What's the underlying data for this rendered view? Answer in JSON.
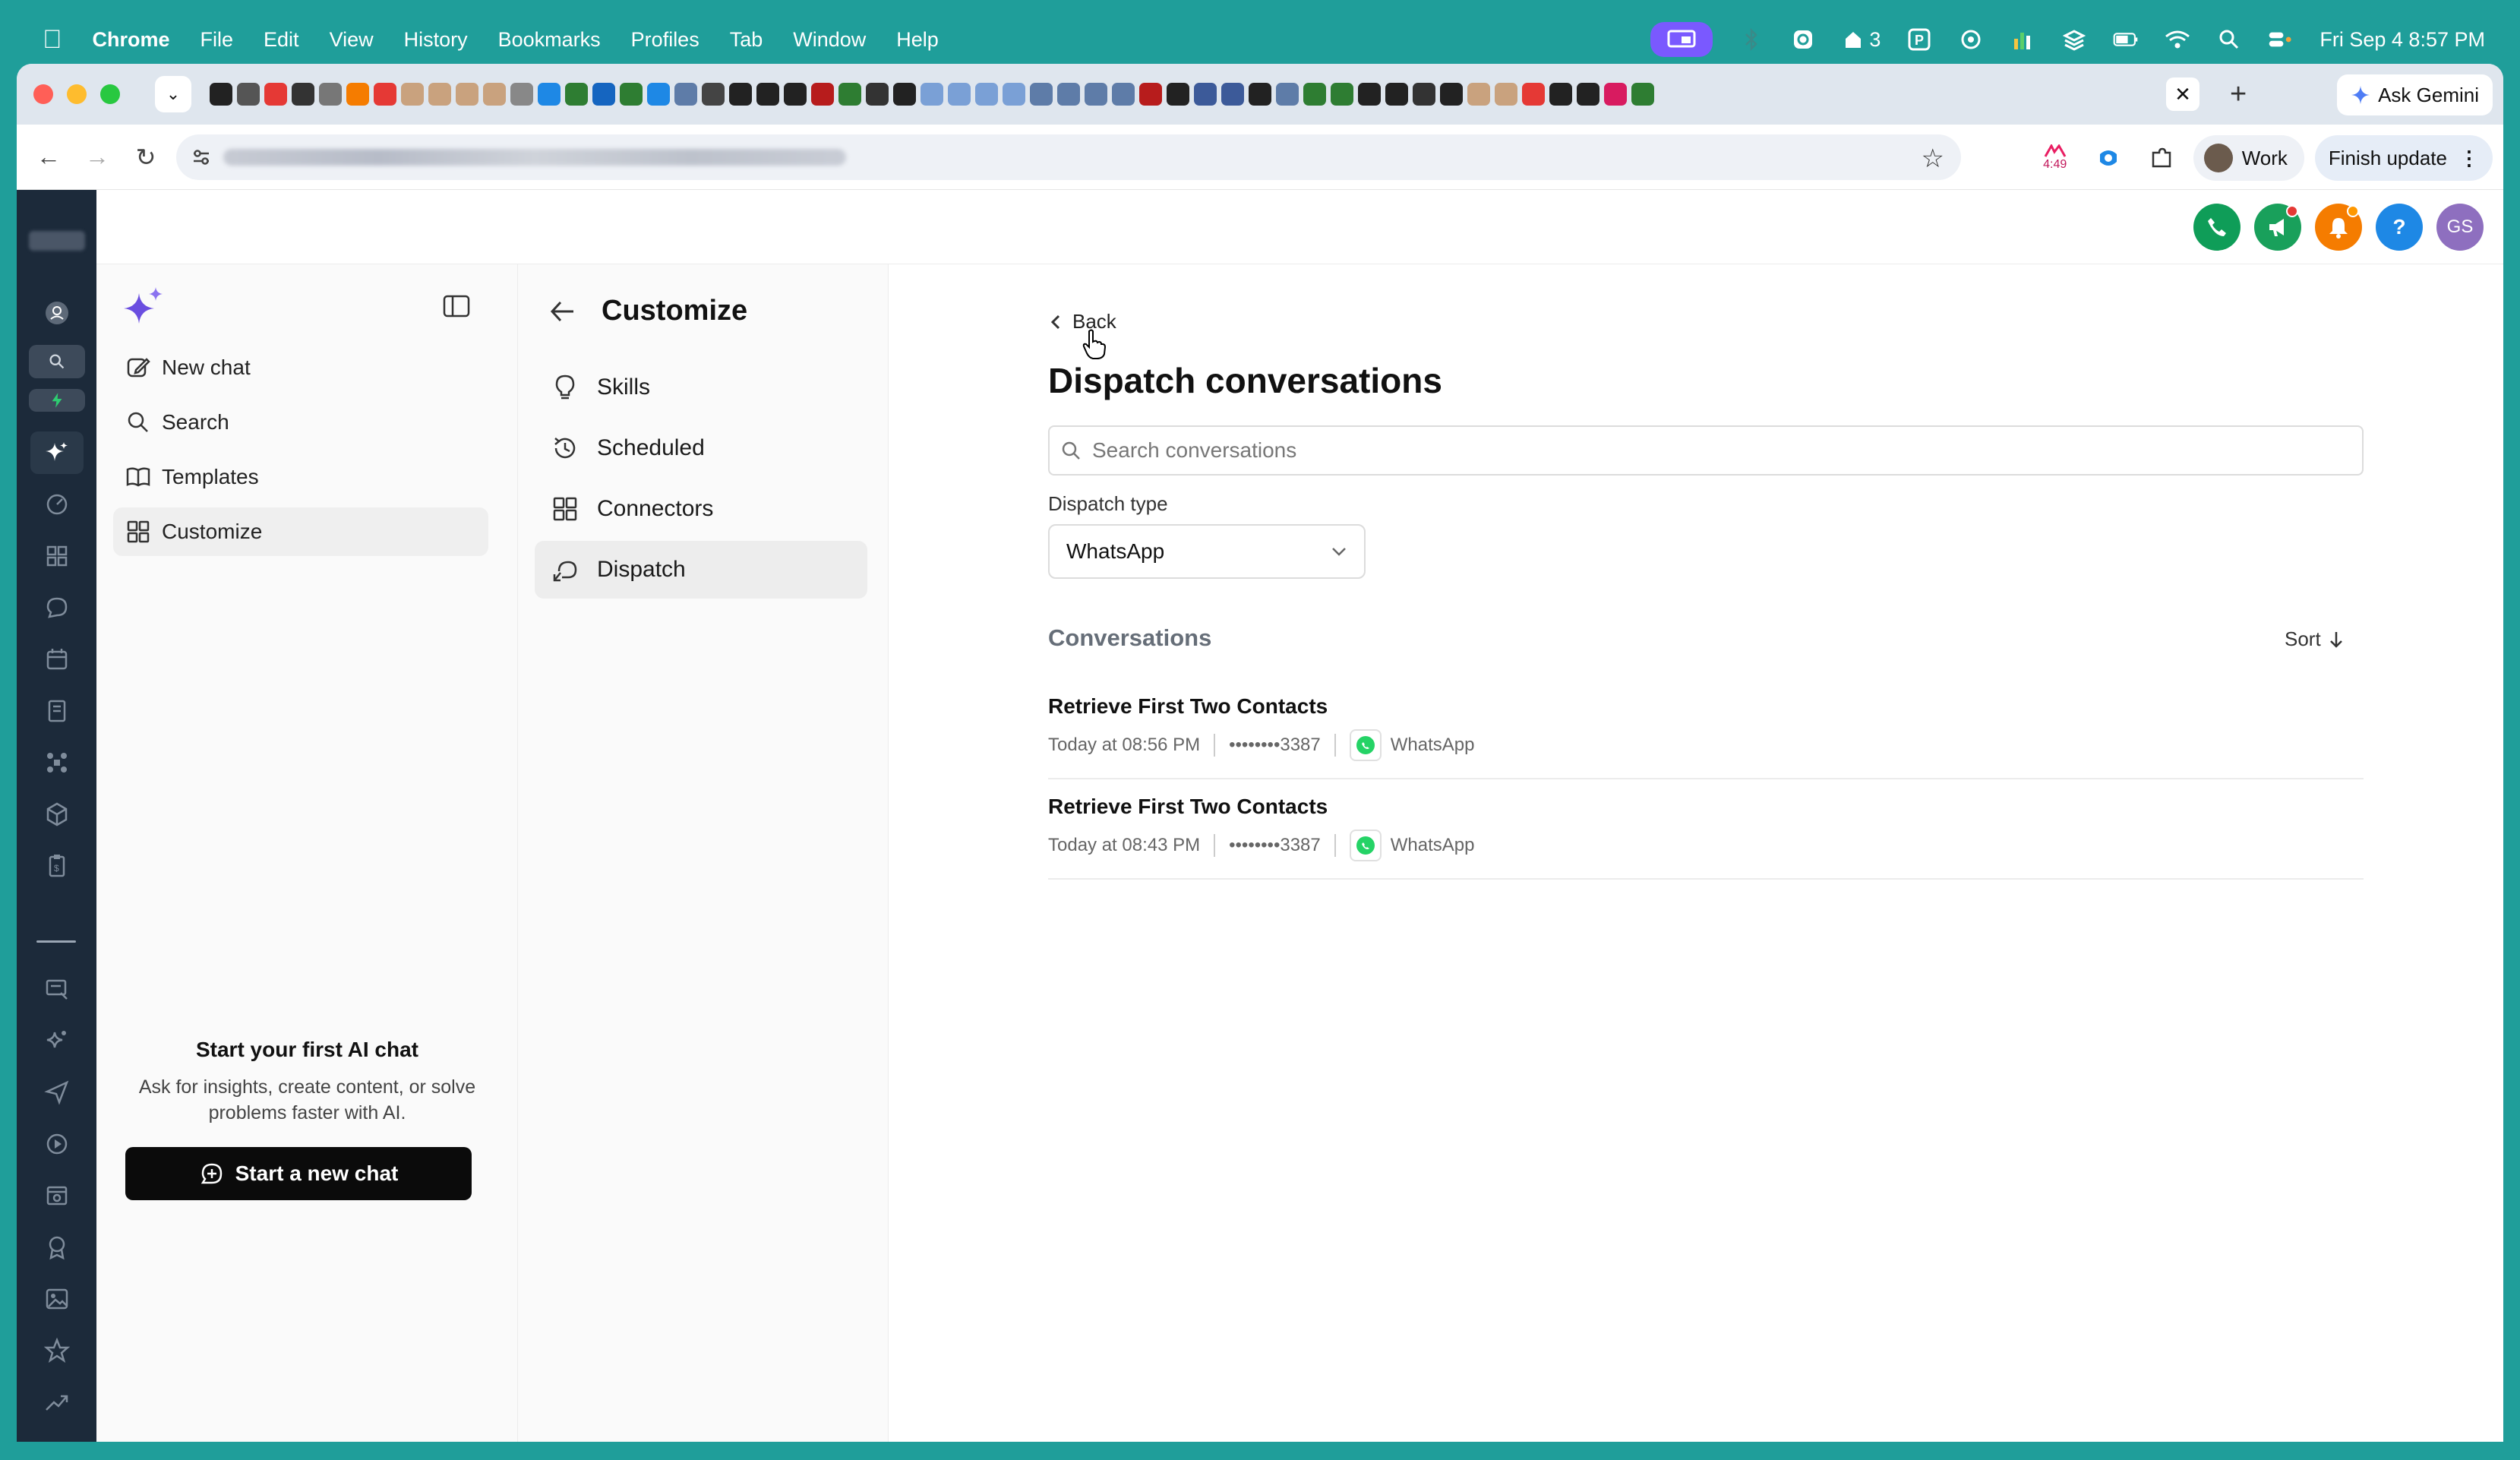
{
  "menubar": {
    "app_name": "Chrome",
    "menus": [
      "File",
      "Edit",
      "View",
      "History",
      "Bookmarks",
      "Profiles",
      "Tab",
      "Window",
      "Help"
    ],
    "status_count": "3",
    "clock": "Fri Sep 4  8:57 PM"
  },
  "browser": {
    "tab_new_symbol": "+",
    "ask_gemini": "Ask Gemini",
    "ext_timer": "4:49",
    "profile_chip": "Work",
    "finish_update": "Finish update"
  },
  "sidebar": {
    "items": [
      {
        "label": "New chat",
        "icon": "edit-icon"
      },
      {
        "label": "Search",
        "icon": "search-icon"
      },
      {
        "label": "Templates",
        "icon": "book-icon"
      },
      {
        "label": "Customize",
        "icon": "grid-icon"
      }
    ],
    "empty_title": "Start your first AI chat",
    "empty_desc": "Ask for insights, create content, or solve problems faster with AI.",
    "start_button": "Start a new chat"
  },
  "customize": {
    "title": "Customize",
    "items": [
      {
        "label": "Skills",
        "icon": "lightbulb-icon"
      },
      {
        "label": "Scheduled",
        "icon": "clock-history-icon"
      },
      {
        "label": "Connectors",
        "icon": "grid-icon"
      },
      {
        "label": "Dispatch",
        "icon": "dispatch-icon"
      }
    ]
  },
  "topbar": {
    "avatar_initials": "GS"
  },
  "main": {
    "back_label": "Back",
    "title": "Dispatch conversations",
    "search_placeholder": "Search conversations",
    "dispatch_type_label": "Dispatch type",
    "dispatch_type_value": "WhatsApp",
    "section_title": "Conversations",
    "sort_label": "Sort",
    "conversations": [
      {
        "title": "Retrieve First Two Contacts",
        "time": "Today at 08:56 PM",
        "phone": "••••••••3387",
        "channel": "WhatsApp"
      },
      {
        "title": "Retrieve First Two Contacts",
        "time": "Today at 08:43 PM",
        "phone": "••••••••3387",
        "channel": "WhatsApp"
      }
    ]
  },
  "colors": {
    "desktop": "#1f9e9a",
    "rail": "#1c2a3a",
    "whatsapp": "#25d366",
    "call_green": "#0f9d58",
    "alert_orange": "#f57c00",
    "help_blue": "#1e88e5",
    "avatar_purple": "#8e6fbf"
  }
}
